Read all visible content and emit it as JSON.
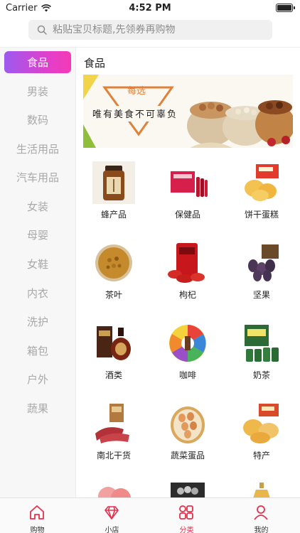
{
  "status_bar": {
    "carrier": "Carrier",
    "time": "4:52 PM"
  },
  "search": {
    "placeholder": "粘贴宝贝标题,先领券再购物"
  },
  "sidebar": {
    "active_index": 0,
    "items": [
      {
        "label": "食品"
      },
      {
        "label": "男装"
      },
      {
        "label": "数码"
      },
      {
        "label": "生活用品"
      },
      {
        "label": "汽车用品"
      },
      {
        "label": "女装"
      },
      {
        "label": "母婴"
      },
      {
        "label": "女鞋"
      },
      {
        "label": "内衣"
      },
      {
        "label": "洗护"
      },
      {
        "label": "箱包"
      },
      {
        "label": "户外"
      },
      {
        "label": "蔬果"
      }
    ]
  },
  "content": {
    "title": "食品",
    "banner": {
      "badge": "每选",
      "slogan": "唯有美食不可辜负"
    },
    "items": [
      {
        "label": "蜂产品"
      },
      {
        "label": "保健品"
      },
      {
        "label": "饼干蛋糕"
      },
      {
        "label": "茶叶"
      },
      {
        "label": "枸杞"
      },
      {
        "label": "坚果"
      },
      {
        "label": "酒类"
      },
      {
        "label": "咖啡"
      },
      {
        "label": "奶茶"
      },
      {
        "label": "南北干货"
      },
      {
        "label": "蔬菜蛋品"
      },
      {
        "label": "特产"
      }
    ]
  },
  "tabbar": {
    "active_index": 2,
    "tabs": [
      {
        "label": "购物",
        "icon": "home-icon"
      },
      {
        "label": "小店",
        "icon": "diamond-icon"
      },
      {
        "label": "分类",
        "icon": "grid-icon"
      },
      {
        "label": "我的",
        "icon": "person-icon"
      }
    ]
  },
  "colors": {
    "accent": "#e5304e",
    "sidebar_gradient_start": "#9d5af0",
    "sidebar_gradient_end": "#f33ab6"
  }
}
